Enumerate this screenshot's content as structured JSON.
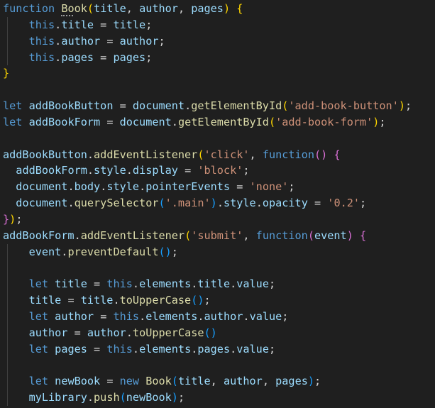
{
  "editor": {
    "background": "#1f1f1f",
    "colors": {
      "keyword": "#569cd6",
      "function_name": "#dcdcaa",
      "variable": "#9cdcfe",
      "string": "#ce9178",
      "plain": "#d4d4d4",
      "brace_yellow": "#ffd700",
      "brace_purple": "#da70d6",
      "brace_blue": "#179fff"
    },
    "lines": [
      {
        "indent": 0,
        "tokens": [
          {
            "t": "function",
            "c": "keyword"
          },
          {
            "t": " ",
            "c": "plain"
          },
          {
            "t": "Book",
            "c": "function_name",
            "squiggle": true
          },
          {
            "t": "(",
            "c": "brace_yellow"
          },
          {
            "t": "title",
            "c": "variable"
          },
          {
            "t": ", ",
            "c": "plain"
          },
          {
            "t": "author",
            "c": "variable"
          },
          {
            "t": ", ",
            "c": "plain"
          },
          {
            "t": "pages",
            "c": "variable"
          },
          {
            "t": ")",
            "c": "brace_yellow"
          },
          {
            "t": " ",
            "c": "plain"
          },
          {
            "t": "{",
            "c": "brace_yellow"
          }
        ]
      },
      {
        "indent": 1,
        "tokens": [
          {
            "t": "    ",
            "c": "plain"
          },
          {
            "t": "this",
            "c": "keyword"
          },
          {
            "t": ".",
            "c": "plain"
          },
          {
            "t": "title",
            "c": "variable"
          },
          {
            "t": " = ",
            "c": "plain"
          },
          {
            "t": "title",
            "c": "variable"
          },
          {
            "t": ";",
            "c": "plain"
          }
        ]
      },
      {
        "indent": 1,
        "tokens": [
          {
            "t": "    ",
            "c": "plain"
          },
          {
            "t": "this",
            "c": "keyword"
          },
          {
            "t": ".",
            "c": "plain"
          },
          {
            "t": "author",
            "c": "variable"
          },
          {
            "t": " = ",
            "c": "plain"
          },
          {
            "t": "author",
            "c": "variable"
          },
          {
            "t": ";",
            "c": "plain"
          }
        ]
      },
      {
        "indent": 1,
        "tokens": [
          {
            "t": "    ",
            "c": "plain"
          },
          {
            "t": "this",
            "c": "keyword"
          },
          {
            "t": ".",
            "c": "plain"
          },
          {
            "t": "pages",
            "c": "variable"
          },
          {
            "t": " = ",
            "c": "plain"
          },
          {
            "t": "pages",
            "c": "variable"
          },
          {
            "t": ";",
            "c": "plain"
          }
        ]
      },
      {
        "indent": 0,
        "tokens": [
          {
            "t": "}",
            "c": "brace_yellow"
          }
        ]
      },
      {
        "indent": 0,
        "tokens": []
      },
      {
        "indent": 0,
        "tokens": [
          {
            "t": "let",
            "c": "keyword"
          },
          {
            "t": " ",
            "c": "plain"
          },
          {
            "t": "addBookButton",
            "c": "variable"
          },
          {
            "t": " = ",
            "c": "plain"
          },
          {
            "t": "document",
            "c": "variable"
          },
          {
            "t": ".",
            "c": "plain"
          },
          {
            "t": "getElementById",
            "c": "function_name"
          },
          {
            "t": "(",
            "c": "brace_yellow"
          },
          {
            "t": "'add-book-button'",
            "c": "string"
          },
          {
            "t": ")",
            "c": "brace_yellow"
          },
          {
            "t": ";",
            "c": "plain"
          }
        ]
      },
      {
        "indent": 0,
        "tokens": [
          {
            "t": "let",
            "c": "keyword"
          },
          {
            "t": " ",
            "c": "plain"
          },
          {
            "t": "addBookForm",
            "c": "variable"
          },
          {
            "t": " = ",
            "c": "plain"
          },
          {
            "t": "document",
            "c": "variable"
          },
          {
            "t": ".",
            "c": "plain"
          },
          {
            "t": "getElementById",
            "c": "function_name"
          },
          {
            "t": "(",
            "c": "brace_yellow"
          },
          {
            "t": "'add-book-form'",
            "c": "string"
          },
          {
            "t": ")",
            "c": "brace_yellow"
          },
          {
            "t": ";",
            "c": "plain"
          }
        ]
      },
      {
        "indent": 0,
        "tokens": []
      },
      {
        "indent": 0,
        "tokens": [
          {
            "t": "addBookButton",
            "c": "variable"
          },
          {
            "t": ".",
            "c": "plain"
          },
          {
            "t": "addEventListener",
            "c": "function_name"
          },
          {
            "t": "(",
            "c": "brace_yellow"
          },
          {
            "t": "'click'",
            "c": "string"
          },
          {
            "t": ", ",
            "c": "plain"
          },
          {
            "t": "function",
            "c": "keyword"
          },
          {
            "t": "(",
            "c": "brace_purple"
          },
          {
            "t": ")",
            "c": "brace_purple"
          },
          {
            "t": " ",
            "c": "plain"
          },
          {
            "t": "{",
            "c": "brace_purple"
          }
        ]
      },
      {
        "indent": 0,
        "tokens": [
          {
            "t": "  ",
            "c": "plain"
          },
          {
            "t": "addBookForm",
            "c": "variable"
          },
          {
            "t": ".",
            "c": "plain"
          },
          {
            "t": "style",
            "c": "variable"
          },
          {
            "t": ".",
            "c": "plain"
          },
          {
            "t": "display",
            "c": "variable"
          },
          {
            "t": " = ",
            "c": "plain"
          },
          {
            "t": "'block'",
            "c": "string"
          },
          {
            "t": ";",
            "c": "plain"
          }
        ]
      },
      {
        "indent": 0,
        "tokens": [
          {
            "t": "  ",
            "c": "plain"
          },
          {
            "t": "document",
            "c": "variable"
          },
          {
            "t": ".",
            "c": "plain"
          },
          {
            "t": "body",
            "c": "variable"
          },
          {
            "t": ".",
            "c": "plain"
          },
          {
            "t": "style",
            "c": "variable"
          },
          {
            "t": ".",
            "c": "plain"
          },
          {
            "t": "pointerEvents",
            "c": "variable"
          },
          {
            "t": " = ",
            "c": "plain"
          },
          {
            "t": "'none'",
            "c": "string"
          },
          {
            "t": ";",
            "c": "plain"
          }
        ]
      },
      {
        "indent": 0,
        "tokens": [
          {
            "t": "  ",
            "c": "plain"
          },
          {
            "t": "document",
            "c": "variable"
          },
          {
            "t": ".",
            "c": "plain"
          },
          {
            "t": "querySelector",
            "c": "function_name"
          },
          {
            "t": "(",
            "c": "brace_blue"
          },
          {
            "t": "'.main'",
            "c": "string"
          },
          {
            "t": ")",
            "c": "brace_blue"
          },
          {
            "t": ".",
            "c": "plain"
          },
          {
            "t": "style",
            "c": "variable"
          },
          {
            "t": ".",
            "c": "plain"
          },
          {
            "t": "opacity",
            "c": "variable"
          },
          {
            "t": " = ",
            "c": "plain"
          },
          {
            "t": "'0.2'",
            "c": "string"
          },
          {
            "t": ";",
            "c": "plain"
          }
        ]
      },
      {
        "indent": 0,
        "tokens": [
          {
            "t": "}",
            "c": "brace_purple"
          },
          {
            "t": ")",
            "c": "brace_yellow"
          },
          {
            "t": ";",
            "c": "plain"
          }
        ]
      },
      {
        "indent": 0,
        "tokens": [
          {
            "t": "addBookForm",
            "c": "variable"
          },
          {
            "t": ".",
            "c": "plain"
          },
          {
            "t": "addEventListener",
            "c": "function_name"
          },
          {
            "t": "(",
            "c": "brace_yellow"
          },
          {
            "t": "'submit'",
            "c": "string"
          },
          {
            "t": ", ",
            "c": "plain"
          },
          {
            "t": "function",
            "c": "keyword"
          },
          {
            "t": "(",
            "c": "brace_purple"
          },
          {
            "t": "event",
            "c": "variable"
          },
          {
            "t": ")",
            "c": "brace_purple"
          },
          {
            "t": " ",
            "c": "plain"
          },
          {
            "t": "{",
            "c": "brace_purple"
          }
        ]
      },
      {
        "indent": 1,
        "tokens": [
          {
            "t": "    ",
            "c": "plain"
          },
          {
            "t": "event",
            "c": "variable"
          },
          {
            "t": ".",
            "c": "plain"
          },
          {
            "t": "preventDefault",
            "c": "function_name"
          },
          {
            "t": "(",
            "c": "brace_blue"
          },
          {
            "t": ")",
            "c": "brace_blue"
          },
          {
            "t": ";",
            "c": "plain"
          }
        ]
      },
      {
        "indent": 1,
        "tokens": []
      },
      {
        "indent": 1,
        "tokens": [
          {
            "t": "    ",
            "c": "plain"
          },
          {
            "t": "let",
            "c": "keyword"
          },
          {
            "t": " ",
            "c": "plain"
          },
          {
            "t": "title",
            "c": "variable"
          },
          {
            "t": " = ",
            "c": "plain"
          },
          {
            "t": "this",
            "c": "keyword"
          },
          {
            "t": ".",
            "c": "plain"
          },
          {
            "t": "elements",
            "c": "variable"
          },
          {
            "t": ".",
            "c": "plain"
          },
          {
            "t": "title",
            "c": "variable"
          },
          {
            "t": ".",
            "c": "plain"
          },
          {
            "t": "value",
            "c": "variable"
          },
          {
            "t": ";",
            "c": "plain"
          }
        ]
      },
      {
        "indent": 1,
        "tokens": [
          {
            "t": "    ",
            "c": "plain"
          },
          {
            "t": "title",
            "c": "variable"
          },
          {
            "t": " = ",
            "c": "plain"
          },
          {
            "t": "title",
            "c": "variable"
          },
          {
            "t": ".",
            "c": "plain"
          },
          {
            "t": "toUpperCase",
            "c": "function_name"
          },
          {
            "t": "(",
            "c": "brace_blue"
          },
          {
            "t": ")",
            "c": "brace_blue"
          },
          {
            "t": ";",
            "c": "plain"
          }
        ]
      },
      {
        "indent": 1,
        "tokens": [
          {
            "t": "    ",
            "c": "plain"
          },
          {
            "t": "let",
            "c": "keyword"
          },
          {
            "t": " ",
            "c": "plain"
          },
          {
            "t": "author",
            "c": "variable"
          },
          {
            "t": " = ",
            "c": "plain"
          },
          {
            "t": "this",
            "c": "keyword"
          },
          {
            "t": ".",
            "c": "plain"
          },
          {
            "t": "elements",
            "c": "variable"
          },
          {
            "t": ".",
            "c": "plain"
          },
          {
            "t": "author",
            "c": "variable"
          },
          {
            "t": ".",
            "c": "plain"
          },
          {
            "t": "value",
            "c": "variable"
          },
          {
            "t": ";",
            "c": "plain"
          }
        ]
      },
      {
        "indent": 1,
        "tokens": [
          {
            "t": "    ",
            "c": "plain"
          },
          {
            "t": "author",
            "c": "variable"
          },
          {
            "t": " = ",
            "c": "plain"
          },
          {
            "t": "author",
            "c": "variable"
          },
          {
            "t": ".",
            "c": "plain"
          },
          {
            "t": "toUpperCase",
            "c": "function_name"
          },
          {
            "t": "(",
            "c": "brace_blue"
          },
          {
            "t": ")",
            "c": "brace_blue"
          }
        ]
      },
      {
        "indent": 1,
        "tokens": [
          {
            "t": "    ",
            "c": "plain"
          },
          {
            "t": "let",
            "c": "keyword"
          },
          {
            "t": " ",
            "c": "plain"
          },
          {
            "t": "pages",
            "c": "variable"
          },
          {
            "t": " = ",
            "c": "plain"
          },
          {
            "t": "this",
            "c": "keyword"
          },
          {
            "t": ".",
            "c": "plain"
          },
          {
            "t": "elements",
            "c": "variable"
          },
          {
            "t": ".",
            "c": "plain"
          },
          {
            "t": "pages",
            "c": "variable"
          },
          {
            "t": ".",
            "c": "plain"
          },
          {
            "t": "value",
            "c": "variable"
          },
          {
            "t": ";",
            "c": "plain"
          }
        ]
      },
      {
        "indent": 1,
        "tokens": []
      },
      {
        "indent": 1,
        "tokens": [
          {
            "t": "    ",
            "c": "plain"
          },
          {
            "t": "let",
            "c": "keyword"
          },
          {
            "t": " ",
            "c": "plain"
          },
          {
            "t": "newBook",
            "c": "variable"
          },
          {
            "t": " = ",
            "c": "plain"
          },
          {
            "t": "new",
            "c": "keyword"
          },
          {
            "t": " ",
            "c": "plain"
          },
          {
            "t": "Book",
            "c": "function_name"
          },
          {
            "t": "(",
            "c": "brace_blue"
          },
          {
            "t": "title",
            "c": "variable"
          },
          {
            "t": ", ",
            "c": "plain"
          },
          {
            "t": "author",
            "c": "variable"
          },
          {
            "t": ", ",
            "c": "plain"
          },
          {
            "t": "pages",
            "c": "variable"
          },
          {
            "t": ")",
            "c": "brace_blue"
          },
          {
            "t": ";",
            "c": "plain"
          }
        ]
      },
      {
        "indent": 1,
        "tokens": [
          {
            "t": "    ",
            "c": "plain"
          },
          {
            "t": "myLibrary",
            "c": "variable"
          },
          {
            "t": ".",
            "c": "plain"
          },
          {
            "t": "push",
            "c": "function_name"
          },
          {
            "t": "(",
            "c": "brace_blue"
          },
          {
            "t": "newBook",
            "c": "variable"
          },
          {
            "t": ")",
            "c": "brace_blue"
          },
          {
            "t": ";",
            "c": "plain"
          }
        ]
      }
    ]
  }
}
